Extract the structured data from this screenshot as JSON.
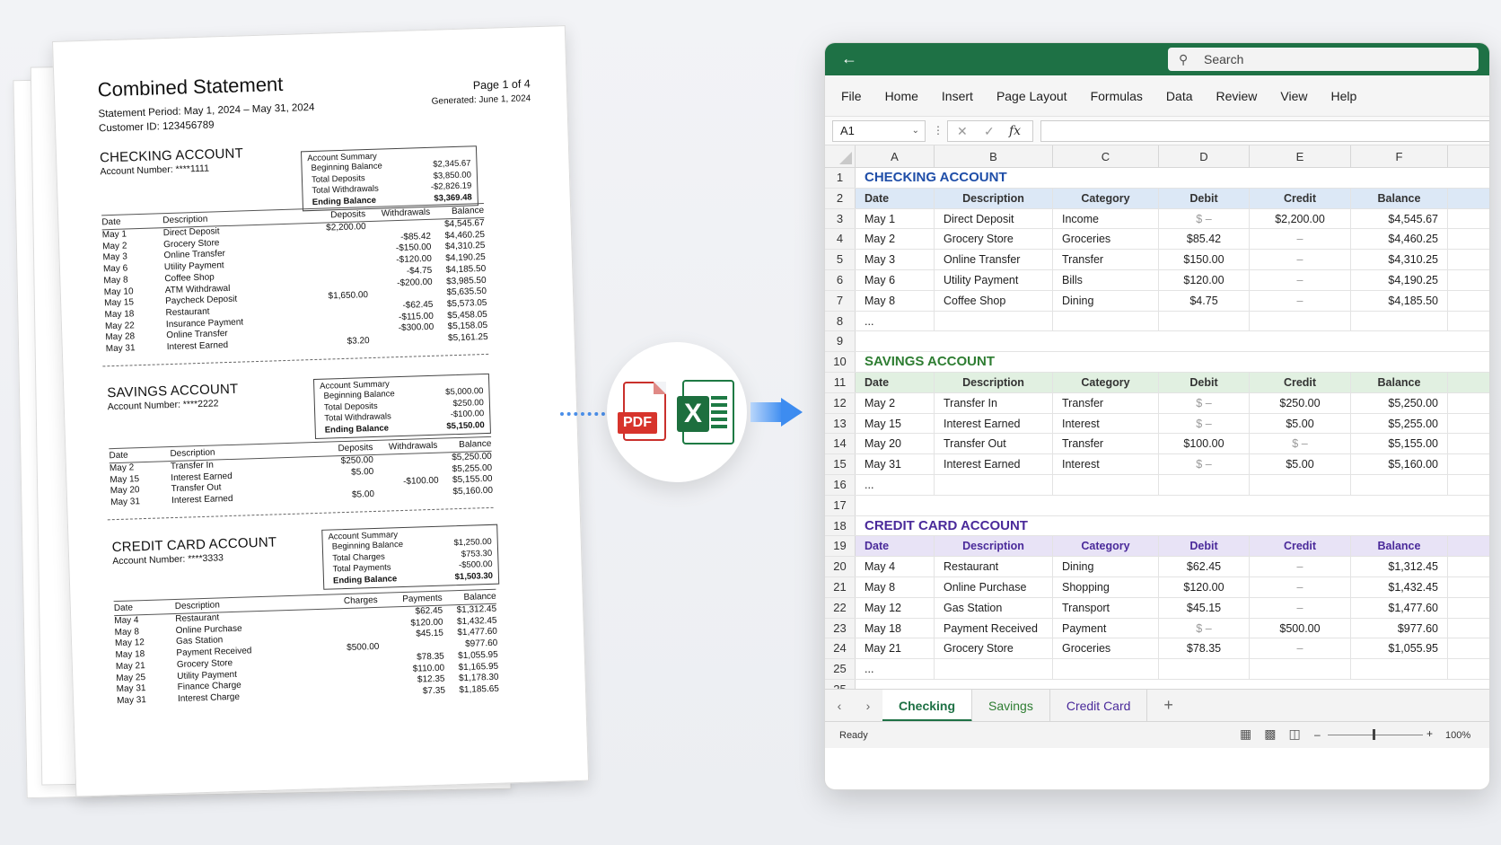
{
  "pdf": {
    "title": "Combined Statement",
    "page": "Page 1 of 4",
    "period": "Statement Period: May 1, 2024 – May 31, 2024",
    "generated": "Generated: June 1, 2024",
    "customer": "Customer ID: 123456789",
    "checking": {
      "heading": "CHECKING ACCOUNT",
      "number": "Account Number: ****1111",
      "summary_title": "Account Summary",
      "summary": [
        {
          "label": "Beginning Balance",
          "value": "$2,345.67"
        },
        {
          "label": "Total Deposits",
          "value": "$3,850.00"
        },
        {
          "label": "Total Withdrawals",
          "value": "-$2,826.19"
        },
        {
          "label": "Ending Balance",
          "value": "$3,369.48"
        }
      ],
      "headers": [
        "Date",
        "Description",
        "Deposits",
        "Withdrawals",
        "Balance"
      ],
      "rows": [
        [
          "May 1",
          "Direct Deposit",
          "$2,200.00",
          "",
          "$4,545.67"
        ],
        [
          "May 2",
          "Grocery Store",
          "",
          "-$85.42",
          "$4,460.25"
        ],
        [
          "May 3",
          "Online Transfer",
          "",
          "-$150.00",
          "$4,310.25"
        ],
        [
          "May 6",
          "Utility Payment",
          "",
          "-$120.00",
          "$4,190.25"
        ],
        [
          "May 8",
          "Coffee Shop",
          "",
          "-$4.75",
          "$4,185.50"
        ],
        [
          "May 10",
          "ATM Withdrawal",
          "",
          "-$200.00",
          "$3,985.50"
        ],
        [
          "May 15",
          "Paycheck Deposit",
          "$1,650.00",
          "",
          "$5,635.50"
        ],
        [
          "May 18",
          "Restaurant",
          "",
          "-$62.45",
          "$5,573.05"
        ],
        [
          "May 22",
          "Insurance Payment",
          "",
          "-$115.00",
          "$5,458.05"
        ],
        [
          "May 28",
          "Online Transfer",
          "",
          "-$300.00",
          "$5,158.05"
        ],
        [
          "May 31",
          "Interest Earned",
          "$3.20",
          "",
          "$5,161.25"
        ]
      ]
    },
    "savings": {
      "heading": "SAVINGS ACCOUNT",
      "number": "Account Number: ****2222",
      "summary_title": "Account Summary",
      "summary": [
        {
          "label": "Beginning Balance",
          "value": "$5,000.00"
        },
        {
          "label": "Total Deposits",
          "value": "$250.00"
        },
        {
          "label": "Total Withdrawals",
          "value": "-$100.00"
        },
        {
          "label": "Ending Balance",
          "value": "$5,150.00"
        }
      ],
      "headers": [
        "Date",
        "Description",
        "Deposits",
        "Withdrawals",
        "Balance"
      ],
      "rows": [
        [
          "May 2",
          "Transfer In",
          "$250.00",
          "",
          "$5,250.00"
        ],
        [
          "May 15",
          "Interest Earned",
          "$5.00",
          "",
          "$5,255.00"
        ],
        [
          "May 20",
          "Transfer Out",
          "",
          "-$100.00",
          "$5,155.00"
        ],
        [
          "May 31",
          "Interest Earned",
          "$5.00",
          "",
          "$5,160.00"
        ]
      ]
    },
    "credit": {
      "heading": "CREDIT CARD ACCOUNT",
      "number": "Account Number: ****3333",
      "summary_title": "Account Summary",
      "summary": [
        {
          "label": "Beginning Balance",
          "value": "$1,250.00"
        },
        {
          "label": "Total Charges",
          "value": "$753.30"
        },
        {
          "label": "Total Payments",
          "value": "-$500.00"
        },
        {
          "label": "Ending Balance",
          "value": "$1,503.30"
        }
      ],
      "headers": [
        "Date",
        "Description",
        "Charges",
        "Payments",
        "Balance"
      ],
      "rows": [
        [
          "May 4",
          "Restaurant",
          "",
          "$62.45",
          "$1,312.45"
        ],
        [
          "May 8",
          "Online Purchase",
          "",
          "$120.00",
          "$1,432.45"
        ],
        [
          "May 12",
          "Gas Station",
          "",
          "$45.15",
          "$1,477.60"
        ],
        [
          "May 18",
          "Payment Received",
          "$500.00",
          "",
          "$977.60"
        ],
        [
          "May 21",
          "Grocery Store",
          "",
          "$78.35",
          "$1,055.95"
        ],
        [
          "May 25",
          "Utility Payment",
          "",
          "$110.00",
          "$1,165.95"
        ],
        [
          "May 31",
          "Finance Charge",
          "",
          "$12.35",
          "$1,178.30"
        ],
        [
          "May 31",
          "Interest Charge",
          "",
          "$7.35",
          "$1,185.65"
        ]
      ]
    }
  },
  "icons": {
    "pdf_label": "PDF",
    "excel_label": "X"
  },
  "excel": {
    "search_placeholder": "Search",
    "menu": [
      "File",
      "Home",
      "Insert",
      "Page Layout",
      "Formulas",
      "Data",
      "Review",
      "View",
      "Help"
    ],
    "name_box": "A1",
    "columns": [
      "A",
      "B",
      "C",
      "D",
      "E",
      "F"
    ],
    "sections": [
      {
        "title": "CHECKING ACCOUNT",
        "color": "#1f4ea8",
        "header_bg": "#dce8f6",
        "title_row": "1",
        "header_row": "2",
        "headers": [
          "Date",
          "Description",
          "Category",
          "Debit",
          "Credit",
          "Balance"
        ],
        "rows": [
          {
            "n": "3",
            "cells": [
              "May 1",
              "Direct Deposit",
              "Income",
              "$ –",
              "$2,200.00",
              "$4,545.67"
            ]
          },
          {
            "n": "4",
            "cells": [
              "May 2",
              "Grocery Store",
              "Groceries",
              "$85.42",
              "–",
              "$4,460.25"
            ]
          },
          {
            "n": "5",
            "cells": [
              "May 3",
              "Online Transfer",
              "Transfer",
              "$150.00",
              "–",
              "$4,310.25"
            ]
          },
          {
            "n": "6",
            "cells": [
              "May 6",
              "Utility Payment",
              "Bills",
              "$120.00",
              "–",
              "$4,190.25"
            ]
          },
          {
            "n": "7",
            "cells": [
              "May 8",
              "Coffee Shop",
              "Dining",
              "$4.75",
              "–",
              "$4,185.50"
            ]
          }
        ],
        "ellipsis_row": "8",
        "blank_rows": [
          "9"
        ]
      },
      {
        "title": "SAVINGS ACCOUNT",
        "color": "#2e7d32",
        "header_bg": "#e1f0e1",
        "title_row": "10",
        "header_row": "11",
        "headers": [
          "Date",
          "Description",
          "Category",
          "Debit",
          "Credit",
          "Balance"
        ],
        "rows": [
          {
            "n": "12",
            "cells": [
              "May 2",
              "Transfer In",
              "Transfer",
              "$ –",
              "$250.00",
              "$5,250.00"
            ]
          },
          {
            "n": "13",
            "cells": [
              "May 15",
              "Interest Earned",
              "Interest",
              "$ –",
              "$5.00",
              "$5,255.00"
            ]
          },
          {
            "n": "14",
            "cells": [
              "May 20",
              "Transfer Out",
              "Transfer",
              "$100.00",
              "$ –",
              "$5,155.00"
            ]
          },
          {
            "n": "15",
            "cells": [
              "May 31",
              "Interest Earned",
              "Interest",
              "$ –",
              "$5.00",
              "$5,160.00"
            ]
          }
        ],
        "ellipsis_row": "16",
        "blank_rows": [
          "17"
        ]
      },
      {
        "title": "CREDIT CARD ACCOUNT",
        "color": "#4a2a9a",
        "header_bg": "#e8e3f6",
        "title_row": "18",
        "header_row": "19",
        "headers": [
          "Date",
          "Description",
          "Category",
          "Debit",
          "Credit",
          "Balance"
        ],
        "rows": [
          {
            "n": "20",
            "cells": [
              "May 4",
              "Restaurant",
              "Dining",
              "$62.45",
              "–",
              "$1,312.45"
            ]
          },
          {
            "n": "21",
            "cells": [
              "May 8",
              "Online Purchase",
              "Shopping",
              "$120.00",
              "–",
              "$1,432.45"
            ]
          },
          {
            "n": "22",
            "cells": [
              "May 12",
              "Gas Station",
              "Transport",
              "$45.15",
              "–",
              "$1,477.60"
            ]
          },
          {
            "n": "23",
            "cells": [
              "May 18",
              "Payment Received",
              "Payment",
              "$ –",
              "$500.00",
              "$977.60"
            ]
          },
          {
            "n": "24",
            "cells": [
              "May 21",
              "Grocery Store",
              "Groceries",
              "$78.35",
              "–",
              "$1,055.95"
            ]
          }
        ],
        "ellipsis_row": "25",
        "blank_rows": [
          "25"
        ]
      }
    ],
    "ellipsis": "...",
    "sheet_tabs": [
      {
        "label": "Checking",
        "color": "#1e7145",
        "active": true
      },
      {
        "label": "Savings",
        "color": "#2e7d32",
        "active": false
      },
      {
        "label": "Credit Card",
        "color": "#4a2a9a",
        "active": false
      }
    ],
    "status": "Ready",
    "zoom": "100%"
  }
}
